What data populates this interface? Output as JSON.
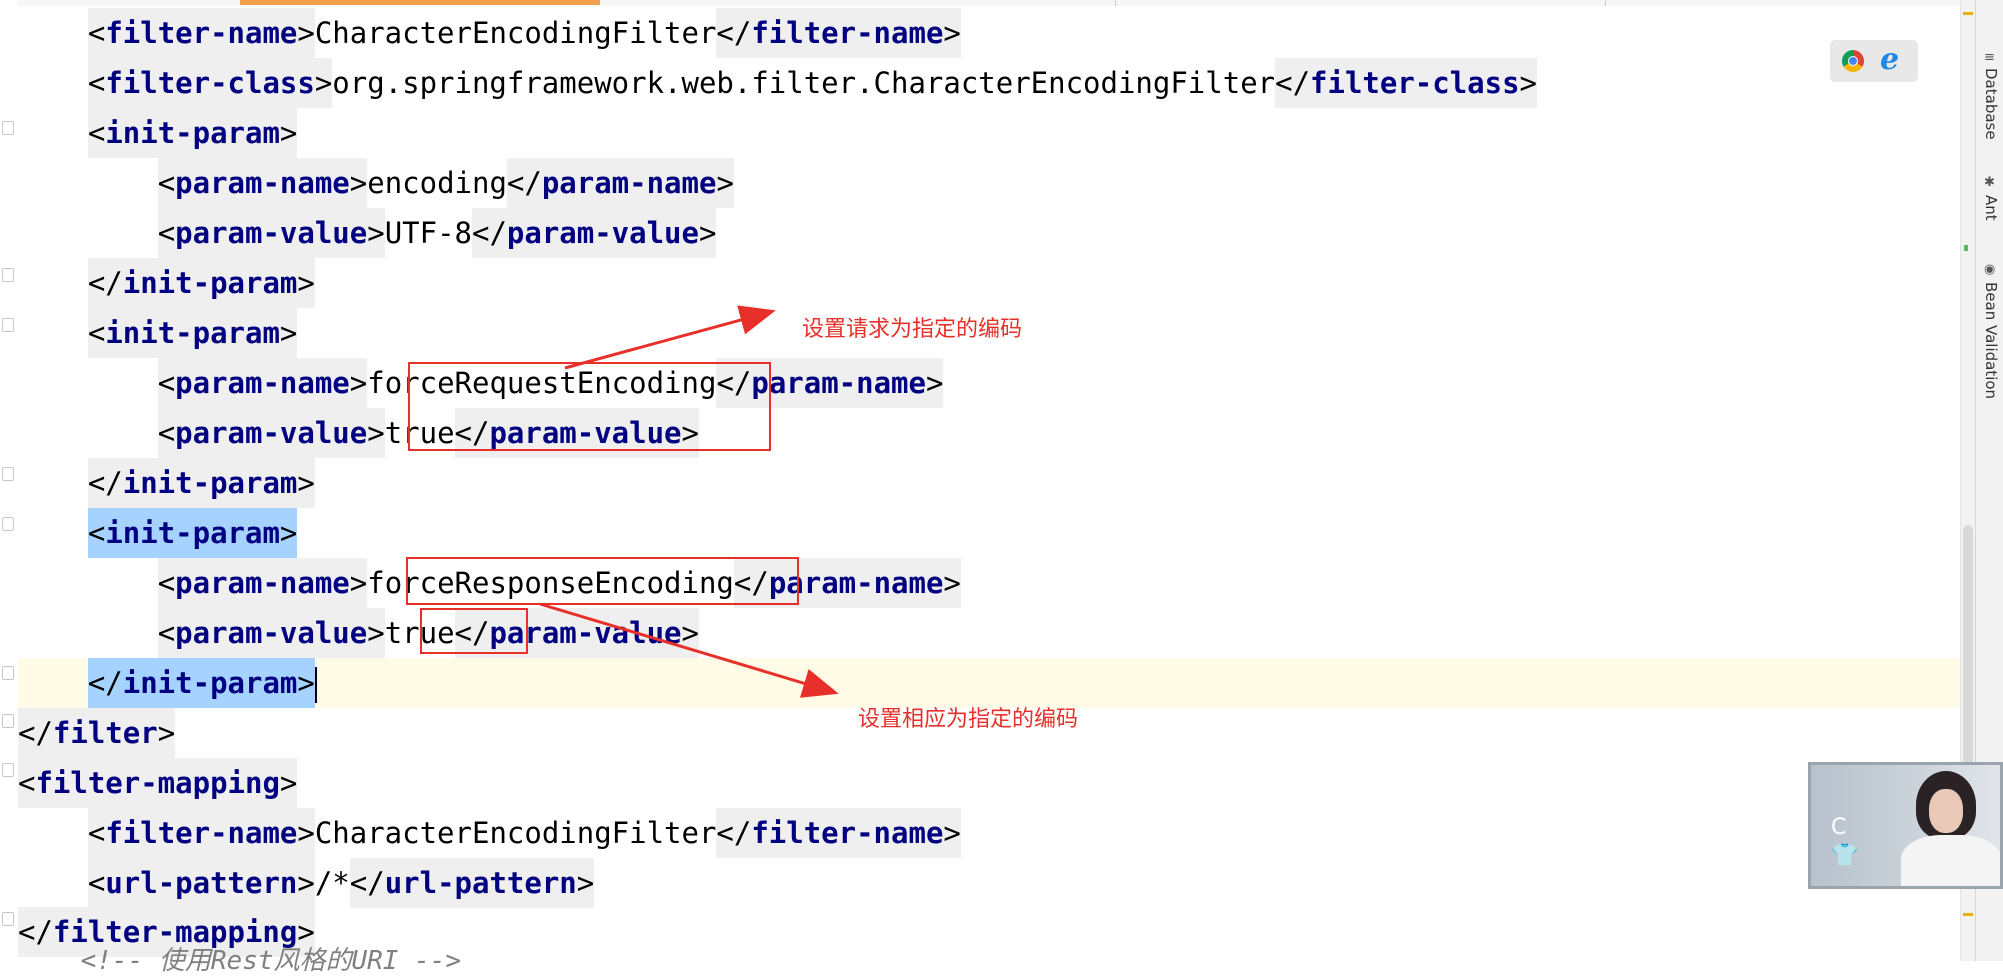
{
  "code_lines": [
    {
      "indent": "    ",
      "open": "filter-name",
      "text": "CharacterEncodingFilter",
      "close": "filter-name"
    },
    {
      "indent": "    ",
      "open": "filter-class",
      "text": "org.springframework.web.filter.CharacterEncodingFilter",
      "close": "filter-class"
    },
    {
      "indent": "    ",
      "open": "init-param"
    },
    {
      "indent": "        ",
      "open": "param-name",
      "text": "encoding",
      "close": "param-name"
    },
    {
      "indent": "        ",
      "open": "param-value",
      "text": "UTF-8",
      "close": "param-value"
    },
    {
      "indent": "    ",
      "close": "init-param"
    },
    {
      "indent": "    ",
      "open": "init-param"
    },
    {
      "indent": "        ",
      "open": "param-name",
      "text": "forceRequestEncoding",
      "close": "param-name"
    },
    {
      "indent": "        ",
      "open": "param-value",
      "text": "true",
      "close": "param-value"
    },
    {
      "indent": "    ",
      "close": "init-param"
    },
    {
      "indent": "    ",
      "open": "init-param"
    },
    {
      "indent": "        ",
      "open": "param-name",
      "text": "forceResponseEncoding",
      "close": "param-name"
    },
    {
      "indent": "        ",
      "open": "param-value",
      "text": "true",
      "close": "param-value"
    },
    {
      "indent": "    ",
      "close": "init-param"
    },
    {
      "indent": "",
      "close": "filter"
    },
    {
      "indent": "",
      "open": "filter-mapping"
    },
    {
      "indent": "    ",
      "open": "filter-name",
      "text": "CharacterEncodingFilter",
      "close": "filter-name"
    },
    {
      "indent": "    ",
      "open": "url-pattern",
      "text": "/*",
      "close": "url-pattern"
    },
    {
      "indent": "",
      "close": "filter-mapping"
    },
    {
      "indent": "    ",
      "comment": "<!-- 使用Rest风格的URI -->"
    }
  ],
  "annotations": {
    "request_note": "设置请求为指定的编码",
    "response_note": "设置相应为指定的编码"
  },
  "right_sidebar": {
    "tabs": [
      {
        "label": "Database",
        "icon": "database-icon"
      },
      {
        "label": "Ant",
        "icon": "ant-icon"
      },
      {
        "label": "Bean Validation",
        "icon": "bean-validation-icon"
      }
    ]
  },
  "browser_icons": [
    "chrome-icon",
    "internet-explorer-icon"
  ],
  "webcam": {
    "glyph_top": "C",
    "glyph_bottom": "👕"
  },
  "colors": {
    "tag": "#000080",
    "annotation": "#e8302a",
    "current_line": "#fffbe6",
    "selection": "#a6d2ff"
  }
}
